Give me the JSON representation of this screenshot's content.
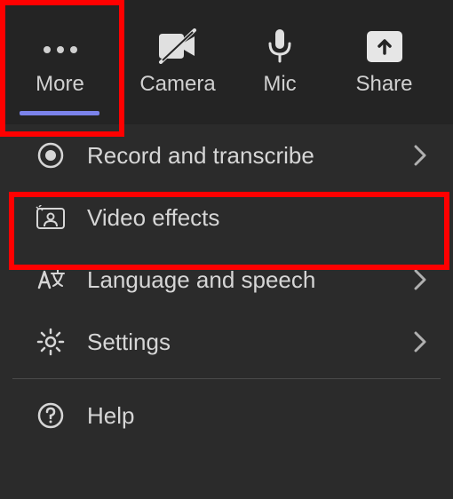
{
  "toolbar": {
    "more_label": "More",
    "camera_label": "Camera",
    "mic_label": "Mic",
    "share_label": "Share"
  },
  "menu": {
    "record_label": "Record and transcribe",
    "video_effects_label": "Video effects",
    "language_label": "Language and speech",
    "settings_label": "Settings",
    "help_label": "Help"
  }
}
